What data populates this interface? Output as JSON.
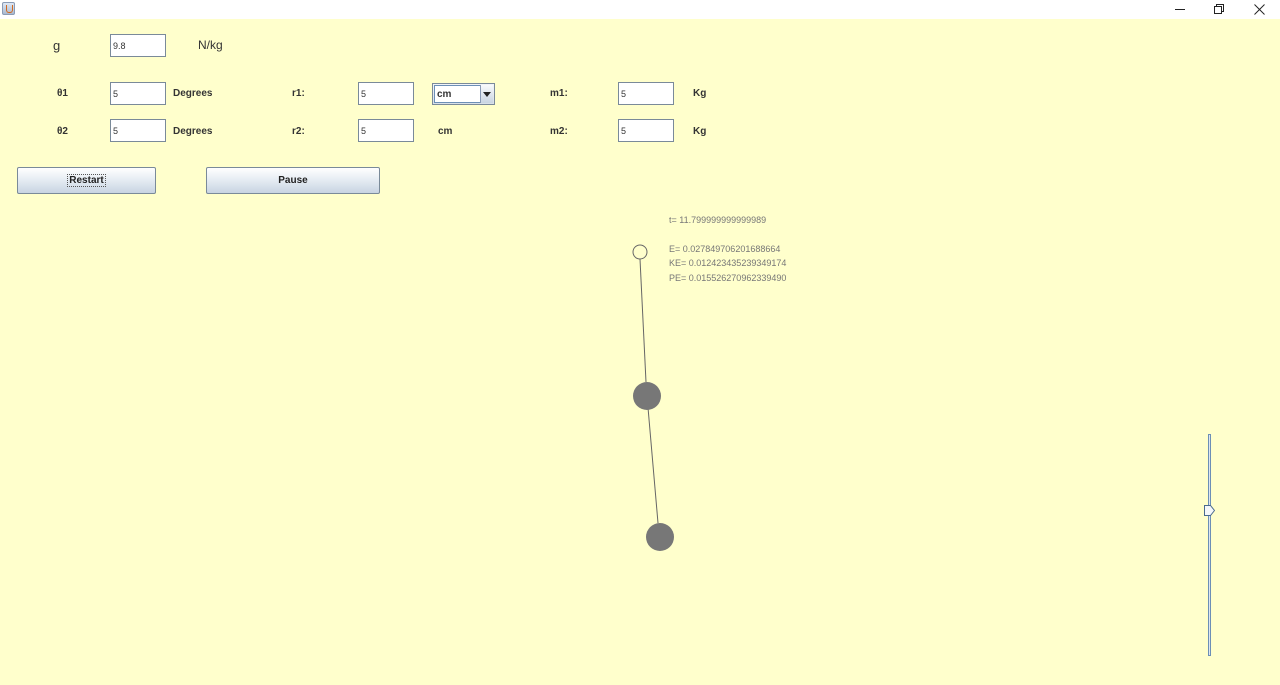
{
  "window": {
    "app_icon": "java-cup-icon",
    "controls": [
      "minimize-icon",
      "restore-icon",
      "close-icon"
    ]
  },
  "gravity": {
    "label": "g",
    "value": "9.8",
    "unit": "N/kg"
  },
  "row1": {
    "theta_label": "θ1",
    "theta_value": "5",
    "theta_unit": "Degrees",
    "r_label": "r1:",
    "r_value": "5",
    "r_unit_selected": "cm",
    "m_label": "m1:",
    "m_value": "5",
    "m_unit": "Kg"
  },
  "row2": {
    "theta_label": "θ2",
    "theta_value": "5",
    "theta_unit": "Degrees",
    "r_label": "r2:",
    "r_value": "5",
    "r_unit": "cm",
    "m_label": "m2:",
    "m_value": "5",
    "m_unit": "Kg"
  },
  "buttons": {
    "restart": "Restart",
    "pause": "Pause"
  },
  "readouts": {
    "time": "t= 11.799999999999989",
    "energy": "E= 0.027849706201688664",
    "kinetic": "KE= 0.012423435239349174",
    "potential": "PE= 0.015526270962339490"
  },
  "colors": {
    "background": "#ffffcc",
    "bob": "#777777",
    "rod": "#666666"
  },
  "slider": {
    "value_fraction": 0.67,
    "orientation": "vertical"
  }
}
